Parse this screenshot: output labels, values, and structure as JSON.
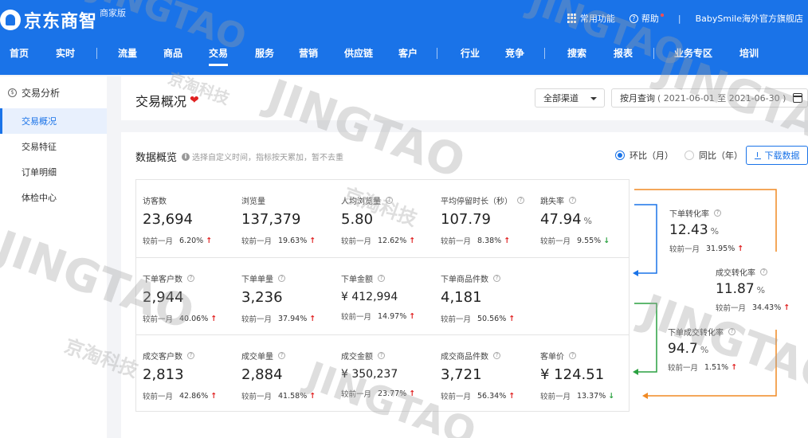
{
  "header": {
    "logo_text": "京东商智",
    "logo_sub": "商家版",
    "common_functions": "常用功能",
    "help": "帮助",
    "separator": "|",
    "shop_name": "BabySmile海外官方旗舰店"
  },
  "nav": [
    "首页",
    "实时",
    "流量",
    "商品",
    "交易",
    "服务",
    "营销",
    "供应链",
    "客户",
    "行业",
    "竞争",
    "搜索",
    "报表",
    "业务专区",
    "培训"
  ],
  "sidebar": {
    "heading": "交易分析",
    "items": [
      "交易概况",
      "交易特征",
      "订单明细",
      "体检中心"
    ]
  },
  "title_card": {
    "title": "交易概况",
    "channel": "全部渠道",
    "date_mode": "按月查询",
    "date_range": "( 2021-06-01 至 2021-06-30 )"
  },
  "overview": {
    "title": "数据概览",
    "hint": "选择自定义时间，指标按天累加，暂不去重",
    "radio_mom": "环比（月）",
    "radio_yoy": "同比（年）",
    "download": "下载数据",
    "compare_label": "较前一月"
  },
  "metrics": [
    [
      {
        "label": "访客数",
        "value": "23,694",
        "change": "6.20%",
        "trend": "up",
        "help": false
      },
      {
        "label": "浏览量",
        "value": "137,379",
        "change": "19.63%",
        "trend": "up",
        "help": false
      },
      {
        "label": "人均浏览量",
        "value": "5.80",
        "change": "12.62%",
        "trend": "up",
        "help": true
      },
      {
        "label": "平均停留时长（秒）",
        "value": "107.79",
        "change": "8.38%",
        "trend": "up",
        "help": true
      },
      {
        "label": "跳失率",
        "value": "47.94",
        "unit": "%",
        "change": "9.55%",
        "trend": "down",
        "help": true
      }
    ],
    [
      {
        "label": "下单客户数",
        "value": "2,944",
        "change": "40.06%",
        "trend": "up",
        "help": true
      },
      {
        "label": "下单单量",
        "value": "3,236",
        "change": "37.94%",
        "trend": "up",
        "help": true
      },
      {
        "label": "下单金额",
        "value": "¥ 412,994",
        "change": "14.97%",
        "trend": "up",
        "help": true,
        "small": true
      },
      {
        "label": "下单商品件数",
        "value": "4,181",
        "change": "50.56%",
        "trend": "up",
        "help": true
      }
    ],
    [
      {
        "label": "成交客户数",
        "value": "2,813",
        "change": "42.86%",
        "trend": "up",
        "help": true
      },
      {
        "label": "成交单量",
        "value": "2,884",
        "change": "41.58%",
        "trend": "up",
        "help": true
      },
      {
        "label": "成交金额",
        "value": "¥ 350,237",
        "change": "23.77%",
        "trend": "up",
        "help": true,
        "small": true
      },
      {
        "label": "成交商品件数",
        "value": "3,721",
        "change": "56.34%",
        "trend": "up",
        "help": true
      },
      {
        "label": "客单价",
        "value": "¥ 124.51",
        "change": "13.37%",
        "trend": "down",
        "help": true
      }
    ]
  ],
  "funnel": [
    {
      "label": "下单转化率",
      "value": "12.43",
      "unit": "%",
      "change": "31.95%",
      "trend": "up"
    },
    {
      "label": "成交转化率",
      "value": "11.87",
      "unit": "%",
      "change": "34.43%",
      "trend": "up"
    },
    {
      "label": "下单成交转化率",
      "value": "94.7",
      "unit": "%",
      "change": "1.51%",
      "trend": "up"
    }
  ],
  "colors": {
    "brand": "#1a73e8",
    "up": "#e02020",
    "down": "#2aa140",
    "funnel_blue": "#1a73e8",
    "funnel_green": "#2aa140",
    "funnel_orange": "#f08a24"
  },
  "watermark": {
    "brand": "JINGTAO",
    "cn": "京淘科技"
  }
}
